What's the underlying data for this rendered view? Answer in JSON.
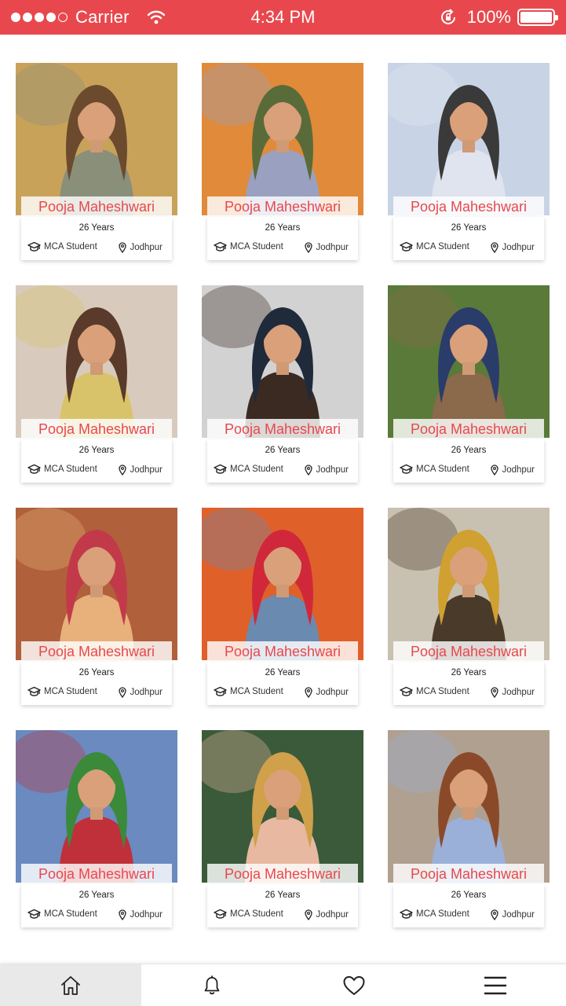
{
  "status_bar": {
    "carrier": "Carrier",
    "time": "4:34 PM",
    "battery": "100%",
    "signal_bars": 4,
    "signal_total": 5
  },
  "colors": {
    "accent": "#e8484d",
    "background": "#ffffff"
  },
  "profiles": [
    {
      "name": "Pooja Maheshwari",
      "age": "26 Years",
      "education": "MCA Student",
      "city": "Jodhpur",
      "photo_palette": [
        "#c9a25a",
        "#6b4a2e",
        "#8a8f7a"
      ]
    },
    {
      "name": "Pooja Maheshwari",
      "age": "26 Years",
      "education": "MCA Student",
      "city": "Jodhpur",
      "photo_palette": [
        "#e08a3a",
        "#5a6b3a",
        "#9aa0c0"
      ]
    },
    {
      "name": "Pooja Maheshwari",
      "age": "26 Years",
      "education": "MCA Student",
      "city": "Jodhpur",
      "photo_palette": [
        "#c8d4e6",
        "#3a3a3a",
        "#dfe4ef"
      ]
    },
    {
      "name": "Pooja Maheshwari",
      "age": "26 Years",
      "education": "MCA Student",
      "city": "Jodhpur",
      "photo_palette": [
        "#d8cbbd",
        "#5a3a2a",
        "#d9c36a"
      ]
    },
    {
      "name": "Pooja Maheshwari",
      "age": "26 Years",
      "education": "MCA Student",
      "city": "Jodhpur",
      "photo_palette": [
        "#d2d2d2",
        "#1f2a3a",
        "#3a2a22"
      ]
    },
    {
      "name": "Pooja Maheshwari",
      "age": "26 Years",
      "education": "MCA Student",
      "city": "Jodhpur",
      "photo_palette": [
        "#5a7a3a",
        "#2a3c6a",
        "#8a6a4a"
      ]
    },
    {
      "name": "Pooja Maheshwari",
      "age": "26 Years",
      "education": "MCA Student",
      "city": "Jodhpur",
      "photo_palette": [
        "#b0603a",
        "#c23a4a",
        "#e8b07a"
      ]
    },
    {
      "name": "Pooja Maheshwari",
      "age": "26 Years",
      "education": "MCA Student",
      "city": "Jodhpur",
      "photo_palette": [
        "#e0602a",
        "#d0283a",
        "#6a8ab0"
      ]
    },
    {
      "name": "Pooja Maheshwari",
      "age": "26 Years",
      "education": "MCA Student",
      "city": "Jodhpur",
      "photo_palette": [
        "#c8c0b0",
        "#d0a030",
        "#4a3a2a"
      ]
    },
    {
      "name": "Pooja Maheshwari",
      "age": "26 Years",
      "education": "MCA Student",
      "city": "Jodhpur",
      "photo_palette": [
        "#6a8ac0",
        "#3a8a3a",
        "#c0303a"
      ]
    },
    {
      "name": "Pooja Maheshwari",
      "age": "26 Years",
      "education": "MCA Student",
      "city": "Jodhpur",
      "photo_palette": [
        "#3a5a3a",
        "#d0a04a",
        "#e8b8a0"
      ]
    },
    {
      "name": "Pooja Maheshwari",
      "age": "26 Years",
      "education": "MCA Student",
      "city": "Jodhpur",
      "photo_palette": [
        "#b0a090",
        "#8a4a2a",
        "#9ab0d8"
      ]
    }
  ],
  "bottom_nav": [
    {
      "icon": "home-icon",
      "active": true
    },
    {
      "icon": "bell-icon",
      "active": false
    },
    {
      "icon": "heart-icon",
      "active": false
    },
    {
      "icon": "menu-icon",
      "active": false
    }
  ]
}
